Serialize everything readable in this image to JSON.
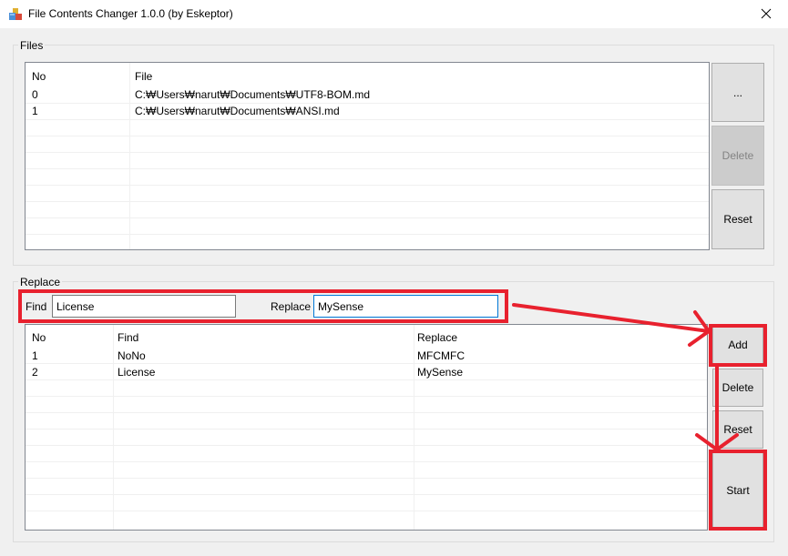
{
  "window": {
    "title": "File Contents Changer 1.0.0 (by Eskeptor)",
    "close_icon": "close-icon"
  },
  "files": {
    "group_label": "Files",
    "columns": [
      "No",
      "File"
    ],
    "rows": [
      {
        "no": "0",
        "file": "C:₩Users₩narut₩Documents₩UTF8-BOM.md"
      },
      {
        "no": "1",
        "file": "C:₩Users₩narut₩Documents₩ANSI.md"
      }
    ],
    "buttons": {
      "browse": "...",
      "delete": "Delete",
      "reset": "Reset"
    }
  },
  "replace": {
    "group_label": "Replace",
    "find_label": "Find",
    "find_value": "License",
    "replace_label": "Replace",
    "replace_value": "MySense",
    "columns": [
      "No",
      "Find",
      "Replace"
    ],
    "rows": [
      {
        "no": "1",
        "find": "NoNo",
        "replace": "MFCMFC"
      },
      {
        "no": "2",
        "find": "License",
        "replace": "MySense"
      }
    ],
    "buttons": {
      "add": "Add",
      "delete": "Delete",
      "reset": "Reset",
      "start": "Start"
    }
  },
  "colors": {
    "annotation": "#e8212e",
    "focus": "#0078d7"
  }
}
